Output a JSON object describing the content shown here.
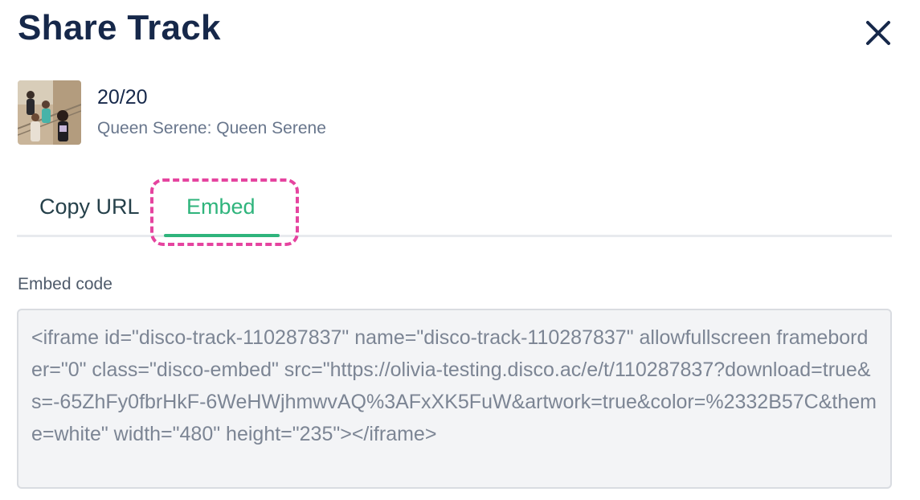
{
  "dialog": {
    "title": "Share Track",
    "close_icon": "close-icon"
  },
  "track": {
    "artwork_icon": "album-artwork",
    "title": "20/20",
    "subtitle": "Queen Serene: Queen Serene"
  },
  "tabs": [
    {
      "label": "Copy URL",
      "active": false
    },
    {
      "label": "Embed",
      "active": true
    }
  ],
  "embed": {
    "label": "Embed code",
    "code": "<iframe id=\"disco-track-110287837\" name=\"disco-track-110287837\" allowfullscreen frameborder=\"0\" class=\"disco-embed\" src=\"https://olivia-testing.disco.ac/e/t/110287837?download=true&s=-65ZhFy0fbrHkF-6WeHWjhmwvAQ%3AFxXK5FuW&artwork=true&color=%2332B57C&theme=white\" width=\"480\" height=\"235\"></iframe>"
  },
  "colors": {
    "accent": "#2fb47c",
    "highlight": "#e5449f",
    "title": "#16284a"
  }
}
